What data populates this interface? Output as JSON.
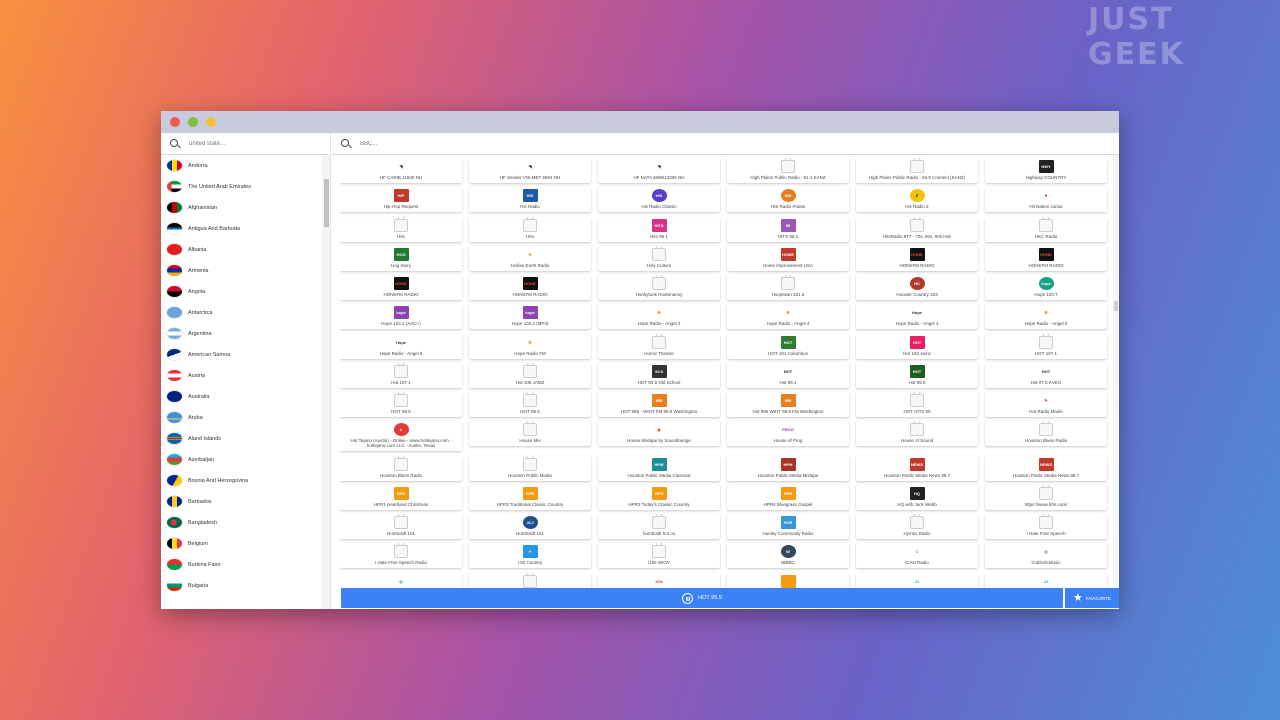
{
  "watermark": "JUST GEEK",
  "sidebar": {
    "search_placeholder": "united state...",
    "countries": [
      {
        "name": "Andorra",
        "flag": "linear-gradient(90deg,#0032a0 33%,#fedd00 33% 66%,#d50032 66%)"
      },
      {
        "name": "The United Arab Emirates",
        "flag": "linear-gradient(90deg,#ef3340 30%,transparent 30%),linear-gradient(#009739 33%,#fff 33% 66%,#000 66%)"
      },
      {
        "name": "Afghanistan",
        "flag": "linear-gradient(90deg,#000 33%,#be0000 33% 66%,#007a36 66%)"
      },
      {
        "name": "Antigua And Barbuda",
        "flag": "linear-gradient(#000 40%,#0072c6 40% 60%,#fff 60%)"
      },
      {
        "name": "Albania",
        "flag": "#e41e20"
      },
      {
        "name": "Armenia",
        "flag": "linear-gradient(#d90012 33%,#0033a0 33% 66%,#f2a800 66%)"
      },
      {
        "name": "Angola",
        "flag": "linear-gradient(#cc092f 50%,#000 50%)"
      },
      {
        "name": "Antarctica",
        "flag": "#6ba4d9"
      },
      {
        "name": "Argentina",
        "flag": "linear-gradient(#74acdf 33%,#fff 33% 66%,#74acdf 66%)"
      },
      {
        "name": "American Samoa",
        "flag": "linear-gradient(160deg,#002b7f 50%,#fff 50%)"
      },
      {
        "name": "Austria",
        "flag": "linear-gradient(#ed2939 33%,#fff 33% 66%,#ed2939 66%)"
      },
      {
        "name": "Australia",
        "flag": "#00247d"
      },
      {
        "name": "Aruba",
        "flag": "linear-gradient(#418fde 60%,#fbe122 60% 70%,#418fde 70%)"
      },
      {
        "name": "Aland Islands",
        "flag": "linear-gradient(#0064ad 40%,#ffd300 40% 45%,#d21034 45% 55%,#ffd300 55% 60%,#0064ad 60%)"
      },
      {
        "name": "Azerbaijan",
        "flag": "linear-gradient(#00b5e2 33%,#ef3340 33% 66%,#509e2f 66%)"
      },
      {
        "name": "Bosnia And Herzegovina",
        "flag": "linear-gradient(120deg,#002395 55%,#fecb00 55%)"
      },
      {
        "name": "Barbados",
        "flag": "linear-gradient(90deg,#00267f 33%,#ffc726 33% 66%,#00267f 66%)"
      },
      {
        "name": "Bangladesh",
        "flag": "radial-gradient(circle at 45% 50%,#f42a41 28%,#006a4e 30%)"
      },
      {
        "name": "Belgium",
        "flag": "linear-gradient(90deg,#000 33%,#fdda24 33% 66%,#ef3340 66%)"
      },
      {
        "name": "Burkina Faso",
        "flag": "linear-gradient(#ef2b2d 50%,#009e49 50%)"
      },
      {
        "name": "Bulgaria",
        "flag": "linear-gradient(#fff 33%,#00966e 33% 66%,#d62612 66%)"
      }
    ]
  },
  "main": {
    "search_placeholder": "BBC...",
    "stations": [
      {
        "name": "HF CARIB 11530 NH",
        "logo": "antenna"
      },
      {
        "name": "HF Sender VOLMET 6604 NH",
        "logo": "antenna"
      },
      {
        "name": "HF NATA 5598/13306 NH",
        "logo": "antenna"
      },
      {
        "name": "High Plains Public Radio - 91.1 KANZ",
        "logo": "tv"
      },
      {
        "name": "High Plains Public Radio - 94.9 Connect (KANZ)",
        "logo": "tv"
      },
      {
        "name": "Highway COUNTRY",
        "logo": "highway"
      },
      {
        "name": "Hip-Hop Request",
        "logo": "hiphop"
      },
      {
        "name": "His Radio",
        "logo": "his"
      },
      {
        "name": "His Radio Classic",
        "logo": "hisclassic"
      },
      {
        "name": "HIS Radio Praise",
        "logo": "hispraise"
      },
      {
        "name": "His Radio Z",
        "logo": "hisz"
      },
      {
        "name": "Hit Nation Junior",
        "logo": "iheart"
      },
      {
        "name": "Hits",
        "logo": "tv"
      },
      {
        "name": "Hits",
        "logo": "tv"
      },
      {
        "name": "Hits 95.1",
        "logo": "hits951"
      },
      {
        "name": "HITS 96.1",
        "logo": "hits961"
      },
      {
        "name": "HitsRadio 977 - 70s, 80s, 90s Hits",
        "logo": "tv"
      },
      {
        "name": "HKC Radio",
        "logo": "tv"
      },
      {
        "name": "Hog Story",
        "logo": "hog"
      },
      {
        "name": "Hollow Earth Radio",
        "logo": "hollow"
      },
      {
        "name": "Holy Culture",
        "logo": "tv"
      },
      {
        "name": "Home Improvement USA",
        "logo": "homeimp"
      },
      {
        "name": "HONKFM RADIO",
        "logo": "honk"
      },
      {
        "name": "HONKFM RADIO",
        "logo": "honk"
      },
      {
        "name": "HONKFM RADIO",
        "logo": "honk"
      },
      {
        "name": "HONKFM RADIO",
        "logo": "honk"
      },
      {
        "name": "Honkytonk Hootenanny",
        "logo": "tv"
      },
      {
        "name": "Hooptown 101.5",
        "logo": "tv"
      },
      {
        "name": "Hoosier Country 103",
        "logo": "hoosier"
      },
      {
        "name": "Hope 100.7",
        "logo": "hope1007"
      },
      {
        "name": "Hope 103.2 (AAC+)",
        "logo": "hope"
      },
      {
        "name": "Hope 103.2 (MP3)",
        "logo": "hope"
      },
      {
        "name": "Hope Radio - Angel 3",
        "logo": "hopeangel"
      },
      {
        "name": "Hope Radio - Angel 4",
        "logo": "hopeangel"
      },
      {
        "name": "Hope Radio - Angel 4",
        "logo": "hopescript"
      },
      {
        "name": "Hope Radio - Angel 5",
        "logo": "hopeangel"
      },
      {
        "name": "Hope Radio - Angel 5",
        "logo": "hopescript"
      },
      {
        "name": "Hope Radio FM",
        "logo": "hopeangel"
      },
      {
        "name": "Horror Theatre",
        "logo": "tv"
      },
      {
        "name": "HOT 101 Columbus",
        "logo": "hot101"
      },
      {
        "name": "Hot 103 Jamz",
        "logo": "hot103"
      },
      {
        "name": "HOT 107.1",
        "logo": "tv"
      },
      {
        "name": "Hot 107.1",
        "logo": "tv"
      },
      {
        "name": "Hot 108 JAMZ",
        "logo": "tv"
      },
      {
        "name": "HOT 93.5 Old School",
        "logo": "hot935"
      },
      {
        "name": "Hot 95.1",
        "logo": "hot951"
      },
      {
        "name": "Hot 95.9",
        "logo": "hot959"
      },
      {
        "name": "Hot 97.5 KVEG",
        "logo": "hot975"
      },
      {
        "name": "HOT 99.5",
        "logo": "tv"
      },
      {
        "name": "HOT 99.5",
        "logo": "tv"
      },
      {
        "name": "HOT 995 - WIHT FM 99.5 Washington",
        "logo": "hot995"
      },
      {
        "name": "Hot 995 WIHT 99.5 FM Washington",
        "logo": "hot995"
      },
      {
        "name": "HOT HITZ 90",
        "logo": "tv"
      },
      {
        "name": "Hot Radio Maine",
        "logo": "hotmaine"
      },
      {
        "name": "Hot Tejano (Austin) - Online - www.hottejano.com - hottejano.com LLC - Austin, Texas",
        "logo": "tejano"
      },
      {
        "name": "House Mix",
        "logo": "tv"
      },
      {
        "name": "House Mixtape by Soundlounge",
        "logo": "soundlounge"
      },
      {
        "name": "House of Prog",
        "logo": "prog"
      },
      {
        "name": "House of Sound",
        "logo": "tv"
      },
      {
        "name": "Houston Blues Radio",
        "logo": "tv"
      },
      {
        "name": "Houston Blues Radio",
        "logo": "tv"
      },
      {
        "name": "Houston Public Media",
        "logo": "tv"
      },
      {
        "name": "Houston Public Media Classical",
        "logo": "hpmclass"
      },
      {
        "name": "Houston Public Media Mixtape",
        "logo": "hpmmix"
      },
      {
        "name": "Houston Public Media News 88.7",
        "logo": "hpmnews"
      },
      {
        "name": "Houston Public Media News 88.7",
        "logo": "hpmnews"
      },
      {
        "name": "HPR1 Heartland Christmas",
        "logo": "hpr"
      },
      {
        "name": "HPR3 Traditional Classic Country",
        "logo": "hpr"
      },
      {
        "name": "HPR3 Today's Classic Country",
        "logo": "hpr"
      },
      {
        "name": "HPR4 Bluegrass Gospel",
        "logo": "hpr"
      },
      {
        "name": "HQ with Jack Webb",
        "logo": "hq"
      },
      {
        "name": "https://www.hfm.com/",
        "logo": "tv"
      },
      {
        "name": "Humboldt 101",
        "logo": "tv"
      },
      {
        "name": "Humboldt 101",
        "logo": "jcj"
      },
      {
        "name": "humboldt hot ox",
        "logo": "tv"
      },
      {
        "name": "Hunley Community Radio",
        "logo": "hunley"
      },
      {
        "name": "Hymns Radio",
        "logo": "tv"
      },
      {
        "name": "I Hate Free Speech",
        "logo": "tv"
      },
      {
        "name": "I Hate Free Speech Radio",
        "logo": "tv"
      },
      {
        "name": "i-92 Country",
        "logo": "i92"
      },
      {
        "name": "i105 WIOV",
        "logo": "tv"
      },
      {
        "name": "IBBBC",
        "logo": "wp"
      },
      {
        "name": "iCAN Radio",
        "logo": "ican"
      },
      {
        "name": "iCatholicMusic",
        "logo": "icath"
      },
      {
        "name": "",
        "logo": "icath"
      },
      {
        "name": "",
        "logo": "tv"
      },
      {
        "name": "",
        "logo": "icn"
      },
      {
        "name": "",
        "logo": "orange"
      },
      {
        "name": "",
        "logo": "jjj"
      },
      {
        "name": "",
        "logo": "jjj"
      }
    ]
  },
  "player": {
    "now_playing": "HOT 95.9",
    "favourite_label": "FAVOURITE"
  },
  "colors": {
    "accent": "#3d82f5"
  }
}
